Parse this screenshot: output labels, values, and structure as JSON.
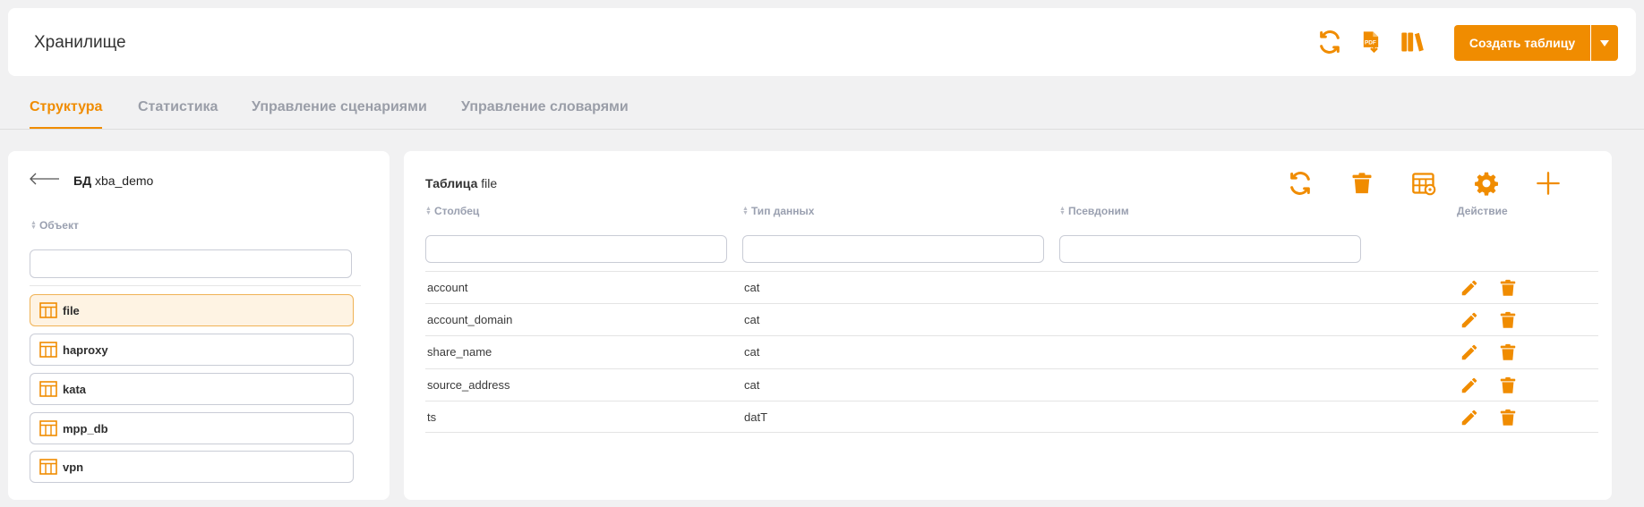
{
  "header": {
    "title": "Хранилище",
    "create_label": "Создать таблицу",
    "icons": [
      "refresh-icon",
      "pdf-export-icon",
      "library-icon"
    ]
  },
  "tabs": [
    {
      "label": "Структура",
      "active": true
    },
    {
      "label": "Статистика",
      "active": false
    },
    {
      "label": "Управление сценариями",
      "active": false
    },
    {
      "label": "Управление словарями",
      "active": false
    }
  ],
  "left": {
    "db_prefix": "БД",
    "db_name": "xba_demo",
    "object_header": "Объект",
    "search_value": "",
    "tables": [
      {
        "label": "file",
        "selected": true
      },
      {
        "label": "haproxy",
        "selected": false
      },
      {
        "label": "kata",
        "selected": false
      },
      {
        "label": "mpp_db",
        "selected": false
      },
      {
        "label": "vpn",
        "selected": false
      }
    ]
  },
  "right": {
    "title_prefix": "Таблица",
    "table_name": "file",
    "toolbar_icons": [
      "refresh-icon",
      "trash-icon",
      "table-settings-icon",
      "gear-icon",
      "plus-icon"
    ],
    "columns": [
      "Столбец",
      "Тип данных",
      "Псевдоним",
      "Действие"
    ],
    "filters": [
      "",
      "",
      ""
    ],
    "rows": [
      {
        "column": "account",
        "type": "cat",
        "alias": ""
      },
      {
        "column": "account_domain",
        "type": "cat",
        "alias": ""
      },
      {
        "column": "share_name",
        "type": "cat",
        "alias": ""
      },
      {
        "column": "source_address",
        "type": "cat",
        "alias": ""
      },
      {
        "column": "ts",
        "type": "datT",
        "alias": ""
      }
    ]
  },
  "colors": {
    "accent": "#f08c00",
    "background": "#f1f1f2",
    "selected_bg": "#fef3e3"
  }
}
